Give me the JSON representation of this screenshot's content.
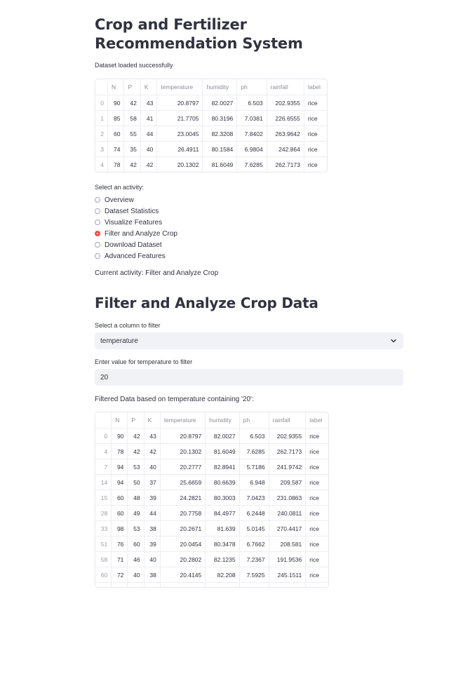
{
  "page": {
    "title": "Crop and Fertilizer Recommendation System",
    "status": "Dataset loaded successfully",
    "activity_label": "Select an activity:",
    "current_activity": "Current activity: Filter and Analyze Crop"
  },
  "activities": [
    {
      "label": "Overview",
      "selected": false
    },
    {
      "label": "Dataset Statistics",
      "selected": false
    },
    {
      "label": "Visualize Features",
      "selected": false
    },
    {
      "label": "Filter and Analyze Crop",
      "selected": true
    },
    {
      "label": "Download Dataset",
      "selected": false
    },
    {
      "label": "Advanced Features",
      "selected": false
    }
  ],
  "columns": [
    "",
    "N",
    "P",
    "K",
    "temperature",
    "humidity",
    "ph",
    "rainfall",
    "label"
  ],
  "preview_rows": [
    [
      "0",
      "90",
      "42",
      "43",
      "20.8797",
      "82.0027",
      "6.503",
      "202.9355",
      "rice"
    ],
    [
      "1",
      "85",
      "58",
      "41",
      "21.7705",
      "80.3196",
      "7.0381",
      "226.6555",
      "rice"
    ],
    [
      "2",
      "60",
      "55",
      "44",
      "23.0045",
      "82.3208",
      "7.8402",
      "263.9642",
      "rice"
    ],
    [
      "3",
      "74",
      "35",
      "40",
      "26.4911",
      "80.1584",
      "6.9804",
      "242.864",
      "rice"
    ],
    [
      "4",
      "78",
      "42",
      "42",
      "20.1302",
      "81.6049",
      "7.6285",
      "262.7173",
      "rice"
    ]
  ],
  "filter": {
    "heading": "Filter and Analyze Crop Data",
    "select_label": "Select a column to filter",
    "selected_column": "temperature",
    "input_label": "Enter value for temperature to filter",
    "input_value": "20",
    "result_label": "Filtered Data based on temperature containing '20':"
  },
  "filtered_rows": [
    [
      "0",
      "90",
      "42",
      "43",
      "20.8797",
      "82.0027",
      "6.503",
      "202.9355",
      "rice"
    ],
    [
      "4",
      "78",
      "42",
      "42",
      "20.1302",
      "81.6049",
      "7.6285",
      "262.7173",
      "rice"
    ],
    [
      "7",
      "94",
      "53",
      "40",
      "20.2777",
      "82.8941",
      "5.7186",
      "241.9742",
      "rice"
    ],
    [
      "14",
      "94",
      "50",
      "37",
      "25.6659",
      "80.6639",
      "6.948",
      "209.587",
      "rice"
    ],
    [
      "15",
      "60",
      "48",
      "39",
      "24.2821",
      "80.3003",
      "7.0423",
      "231.0863",
      "rice"
    ],
    [
      "28",
      "60",
      "49",
      "44",
      "20.7758",
      "84.4977",
      "6.2448",
      "240.0811",
      "rice"
    ],
    [
      "33",
      "98",
      "53",
      "38",
      "20.2671",
      "81.639",
      "5.0145",
      "270.4417",
      "rice"
    ],
    [
      "51",
      "76",
      "60",
      "39",
      "20.0454",
      "80.3478",
      "6.7662",
      "208.581",
      "rice"
    ],
    [
      "58",
      "71",
      "46",
      "40",
      "20.2802",
      "82.1235",
      "7.2367",
      "191.9536",
      "rice"
    ],
    [
      "60",
      "72",
      "40",
      "38",
      "20.4145",
      "82.208",
      "7.5925",
      "245.1511",
      "rice"
    ]
  ],
  "colors": {
    "accent": "#ff4b4b",
    "input_bg": "#f0f2f6"
  }
}
